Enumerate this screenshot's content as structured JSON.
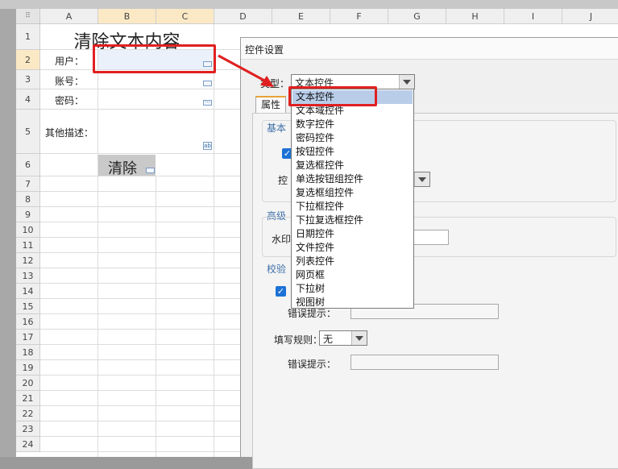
{
  "spreadsheet": {
    "columns": [
      "A",
      "B",
      "C",
      "D",
      "E",
      "F",
      "G",
      "H",
      "I",
      "J"
    ],
    "rows": [
      "1",
      "2",
      "3",
      "4",
      "5",
      "6",
      "7",
      "8",
      "9",
      "10",
      "11",
      "12",
      "13",
      "14",
      "15",
      "16",
      "17",
      "18",
      "19",
      "20",
      "21",
      "22",
      "23",
      "24"
    ],
    "title": "清除文本内容",
    "labels": {
      "user": "用户：",
      "account": "账号：",
      "password": "密码：",
      "description": "其他描述："
    },
    "clear_button": "清除",
    "corner_icon": "grid-icon"
  },
  "dialog": {
    "title": "控件设置",
    "type_label": "类型：",
    "type_value": "文本控件",
    "tab_label": "属性",
    "section_basic": "基本",
    "section_advanced": "高级",
    "section_validate": "校验",
    "control_name_label": "控",
    "watermark_label": "水印",
    "error_hint_label_1": "错误提示：",
    "fill_rule_label": "填写规则：",
    "fill_rule_value": "无",
    "error_hint_label_2": "错误提示："
  },
  "dropdown": {
    "options": [
      "文本控件",
      "文本域控件",
      "数字控件",
      "密码控件",
      "按钮控件",
      "复选框控件",
      "单选按钮组控件",
      "复选框组控件",
      "下拉框控件",
      "下拉复选框控件",
      "日期控件",
      "文件控件",
      "列表控件",
      "网页框",
      "下拉树",
      "视图树"
    ],
    "selected_index": 0
  },
  "colors": {
    "highlight": "#e02020",
    "selected_header": "#fbe9c5",
    "checkbox": "#1c72d6"
  }
}
